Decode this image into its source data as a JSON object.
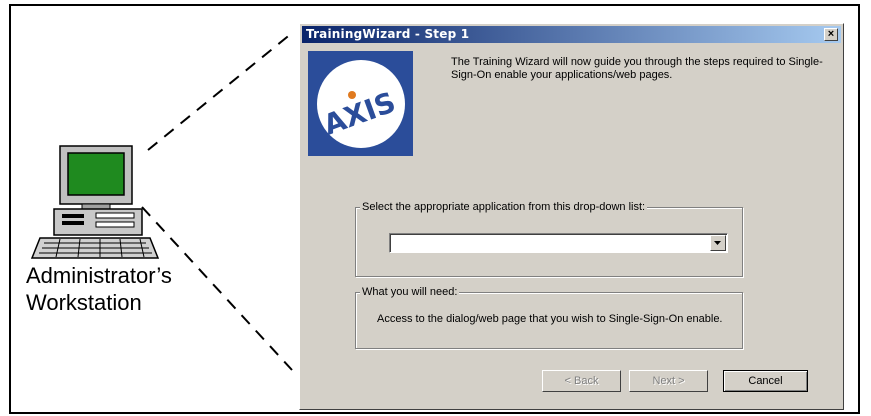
{
  "workstation": {
    "label_line1": "Administrator’s",
    "label_line2": "Workstation"
  },
  "dialog": {
    "title": "TrainingWizard  -  Step 1",
    "close_glyph": "×",
    "logo_text": "AXIS",
    "intro_text": "The Training Wizard will now guide you through the steps required to Single-Sign-On enable your applications/web pages.",
    "select_group": {
      "legend": "Select the appropriate application from this drop-down list:",
      "selected_value": ""
    },
    "need_group": {
      "legend": "What you will need:",
      "text": "Access to the dialog/web page that you wish to Single-Sign-On enable."
    },
    "buttons": {
      "back": "< Back",
      "next": "Next >",
      "cancel": "Cancel"
    }
  },
  "colors": {
    "dialog_face": "#d4d0c8",
    "titlebar_start": "#0a246a",
    "titlebar_end": "#a6caf0",
    "logo_blue": "#2b4d9a",
    "logo_dot": "#e07a1f",
    "monitor_screen": "#1f8a1f"
  }
}
